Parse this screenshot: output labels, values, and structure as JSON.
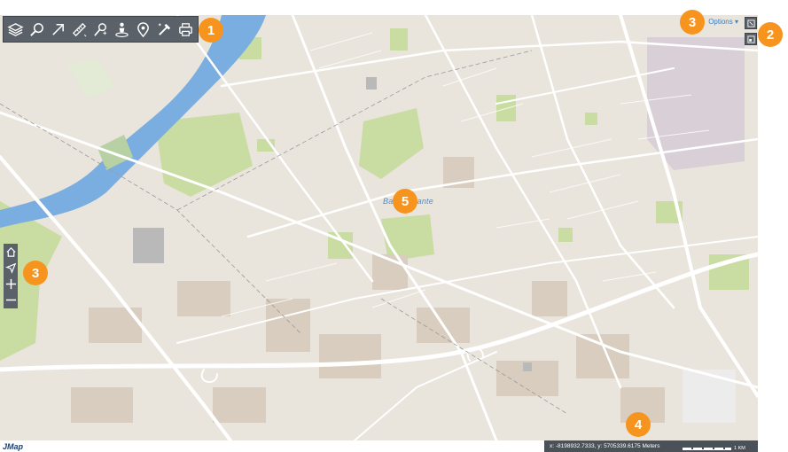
{
  "toolbar": {
    "tools": [
      {
        "name": "layers-icon"
      },
      {
        "name": "search-icon"
      },
      {
        "name": "select-arrow-icon"
      },
      {
        "name": "measure-ruler-icon"
      },
      {
        "name": "geocode-pin-icon"
      },
      {
        "name": "streetview-person-icon"
      },
      {
        "name": "location-marker-icon"
      },
      {
        "name": "edit-tools-icon"
      },
      {
        "name": "print-icon"
      }
    ]
  },
  "options": {
    "label": "Options ▾"
  },
  "map": {
    "place_label": "Bas Brunante",
    "coordinates": "x: -8198932.7333, y: 5705339.6175 Meters",
    "scale_label": "1 KM"
  },
  "brand": {
    "logo_text": "JMap"
  },
  "badges": {
    "b1": "1",
    "b2": "2",
    "b3a": "3",
    "b3b": "3",
    "b4": "4",
    "b5": "5"
  },
  "colors": {
    "badge": "#f7941d",
    "toolbar": "#5a6168",
    "water": "#7aaee0",
    "park": "#c9dca2",
    "land": "#e9e4dc",
    "road": "#ffffff"
  }
}
